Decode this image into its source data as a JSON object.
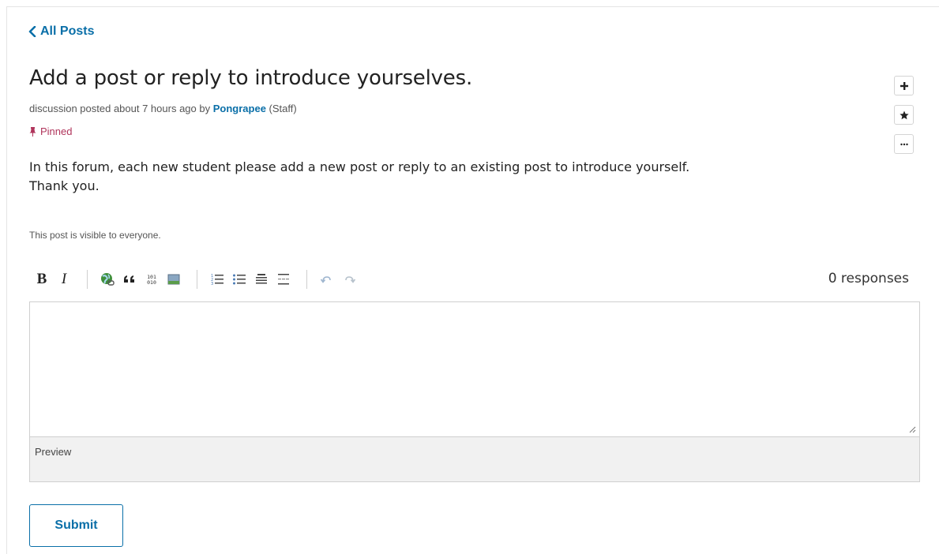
{
  "nav": {
    "back_label": "All Posts"
  },
  "post": {
    "title": "Add a post or reply to introduce yourselves.",
    "meta_prefix": "discussion posted about 7 hours ago by",
    "author": "Pongrapee",
    "author_role": "(Staff)",
    "pinned_label": "Pinned",
    "body_line1": "In this forum, each new student please add a new post or reply to an existing post to introduce yourself.",
    "body_line2": "Thank you.",
    "visibility": "This post is visible to everyone."
  },
  "actions": {
    "follow_icon": "plus-icon",
    "star_icon": "star-icon",
    "more_icon": "ellipsis-icon"
  },
  "editor": {
    "toolbar": {
      "bold": "B",
      "italic": "I",
      "icons": [
        "link-icon",
        "quote-icon",
        "code-icon",
        "image-icon",
        "numbered-list-icon",
        "bulleted-list-icon",
        "heading-icon",
        "horizontal-rule-icon",
        "undo-icon",
        "redo-icon"
      ]
    },
    "responses_label": "0 responses",
    "value": "",
    "preview_label": "Preview",
    "submit_label": "Submit"
  },
  "colors": {
    "link": "#0a6fa8",
    "pinned": "#b0345b",
    "preview_bg": "#f1f1f1"
  }
}
